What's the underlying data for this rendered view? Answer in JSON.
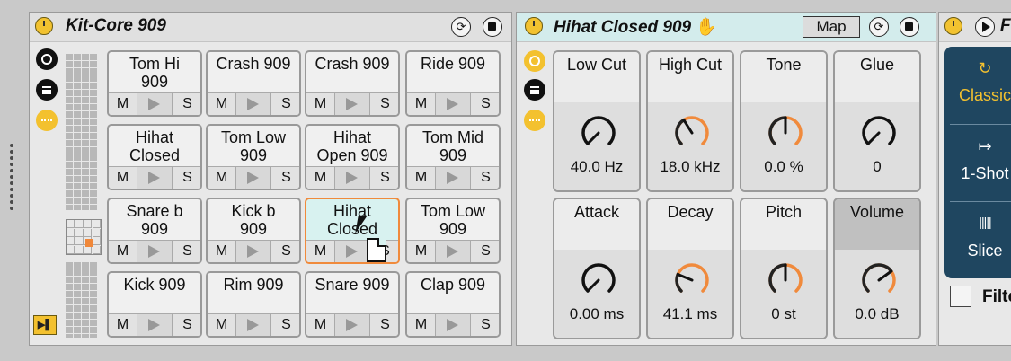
{
  "kit": {
    "title": "Kit-Core 909",
    "follow_label": "▶▌",
    "pads": [
      {
        "name": "Tom Hi\n909",
        "selected": false
      },
      {
        "name": "Crash 909",
        "selected": false
      },
      {
        "name": "Crash 909",
        "selected": false
      },
      {
        "name": "Ride 909",
        "selected": false
      },
      {
        "name": "Hihat\nClosed",
        "selected": false
      },
      {
        "name": "Tom Low\n909",
        "selected": false
      },
      {
        "name": "Hihat\nOpen 909",
        "selected": false
      },
      {
        "name": "Tom Mid\n909",
        "selected": false
      },
      {
        "name": "Snare b\n909",
        "selected": false
      },
      {
        "name": "Kick b\n909",
        "selected": false
      },
      {
        "name": "Hihat\nClosed",
        "selected": true
      },
      {
        "name": "Tom Low\n909",
        "selected": false
      },
      {
        "name": "Kick 909",
        "selected": false
      },
      {
        "name": "Rim 909",
        "selected": false
      },
      {
        "name": "Snare 909",
        "selected": false
      },
      {
        "name": "Clap 909",
        "selected": false
      }
    ],
    "pad_controls": {
      "mute": "M",
      "solo": "S"
    }
  },
  "sampler": {
    "title": "Hihat Closed 909",
    "map_label": "Map",
    "knobs": [
      {
        "label": "Low Cut",
        "value": "40.0 Hz",
        "pos": 0.0,
        "color": "#111111"
      },
      {
        "label": "High Cut",
        "value": "18.0 kHz",
        "pos": 0.38,
        "color": "#f08a3c"
      },
      {
        "label": "Tone",
        "value": "0.0 %",
        "pos": 0.5,
        "color": "#f08a3c"
      },
      {
        "label": "Glue",
        "value": "0",
        "pos": 0.0,
        "color": "#111111"
      },
      {
        "label": "Attack",
        "value": "0.00 ms",
        "pos": 0.0,
        "color": "#111111"
      },
      {
        "label": "Decay",
        "value": "41.1 ms",
        "pos": 0.25,
        "color": "#f08a3c"
      },
      {
        "label": "Pitch",
        "value": "0 st",
        "pos": 0.5,
        "color": "#f08a3c"
      },
      {
        "label": "Volume",
        "value": "0.0 dB",
        "pos": 0.7,
        "color": "#f08a3c"
      }
    ]
  },
  "simpler": {
    "title_partial": "F",
    "modes": [
      {
        "icon": "↻",
        "label": "Classic",
        "selected": true
      },
      {
        "icon": "↦",
        "label": "1-Shot",
        "selected": false
      },
      {
        "icon": "|||||",
        "label": "Slice",
        "selected": false
      }
    ],
    "filter_label": "Filte"
  },
  "colors": {
    "accent": "#f08a3c",
    "power": "#f3c12f",
    "selected_pad": "#d8f2f0",
    "mode_panel": "#1f4660"
  }
}
